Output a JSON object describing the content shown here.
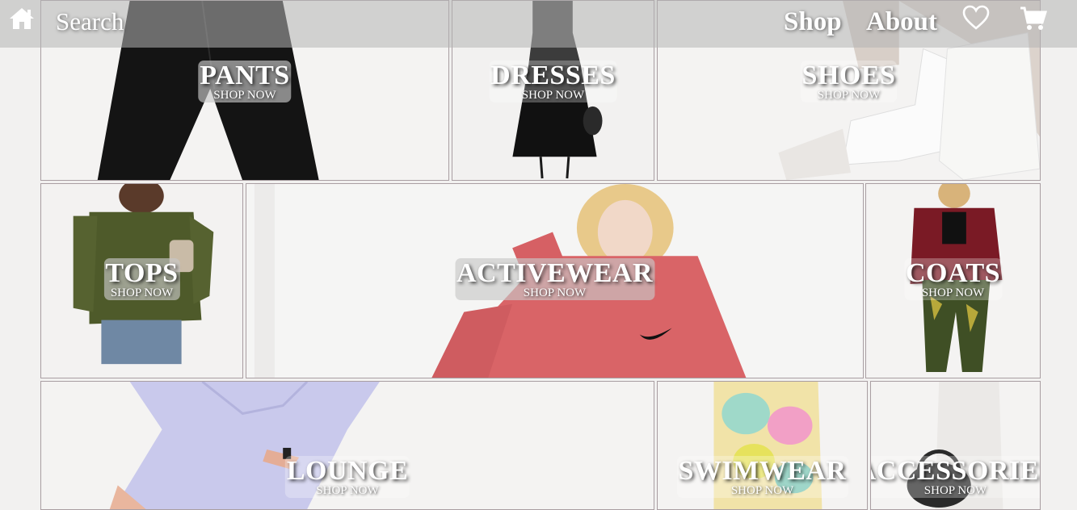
{
  "nav": {
    "home_icon": "home-icon",
    "search_label": "Search",
    "shop_label": "Shop",
    "about_label": "About",
    "wishlist_icon": "heart-icon",
    "cart_icon": "cart-icon"
  },
  "categories": [
    {
      "title": "PANTS",
      "cta": "SHOP NOW"
    },
    {
      "title": "DRESSES",
      "cta": "SHOP NOW"
    },
    {
      "title": "SHOES",
      "cta": "SHOP NOW"
    },
    {
      "title": "TOPS",
      "cta": "SHOP NOW"
    },
    {
      "title": "ACTIVEWEAR",
      "cta": "SHOP NOW"
    },
    {
      "title": "COATS",
      "cta": "SHOP NOW"
    },
    {
      "title": "LOUNGE",
      "cta": "SHOP NOW"
    },
    {
      "title": "SWIMWEAR",
      "cta": "SHOP NOW"
    },
    {
      "title": "ACCESSORIES",
      "cta": "SHOP NOW"
    }
  ],
  "colors": {
    "page_bg": "#f2f1f0",
    "nav_bg": "rgba(180,180,180,0.55)",
    "label_text": "#ffffff",
    "tile_border": "#a99ea2"
  }
}
